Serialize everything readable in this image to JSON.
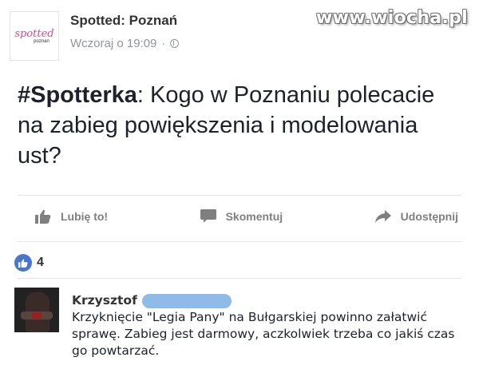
{
  "watermark": "www.wiocha.pl",
  "page": {
    "avatar_text": "spotted",
    "avatar_subtext": "poznan",
    "name": "Spotted: Poznań",
    "timestamp": "Wczoraj o 19:09",
    "separator": "·",
    "privacy_icon": "globe-icon"
  },
  "post": {
    "hashtag": "#Spotterka",
    "text": ": Kogo w Poznaniu polecacie na zabieg powiększenia i modelowania ust?"
  },
  "actions": {
    "like_label": "Lubię to!",
    "comment_label": "Skomentuj",
    "share_label": "Udostępnij"
  },
  "reactions": {
    "icon": "thumbs-up-icon",
    "count": "4"
  },
  "comment": {
    "author": "Krzysztof",
    "text": "Krzyknięcie \"Legia Pany\" na Bułgarskiej powinno załatwić sprawę. Zabieg jest darmowy, aczkolwiek trzeba co jakiś czas go powtarzać."
  },
  "colors": {
    "accent": "#4a76c9",
    "logo": "#d84a8c",
    "muted_text": "#90949c",
    "redaction": "#8fbbe8"
  }
}
